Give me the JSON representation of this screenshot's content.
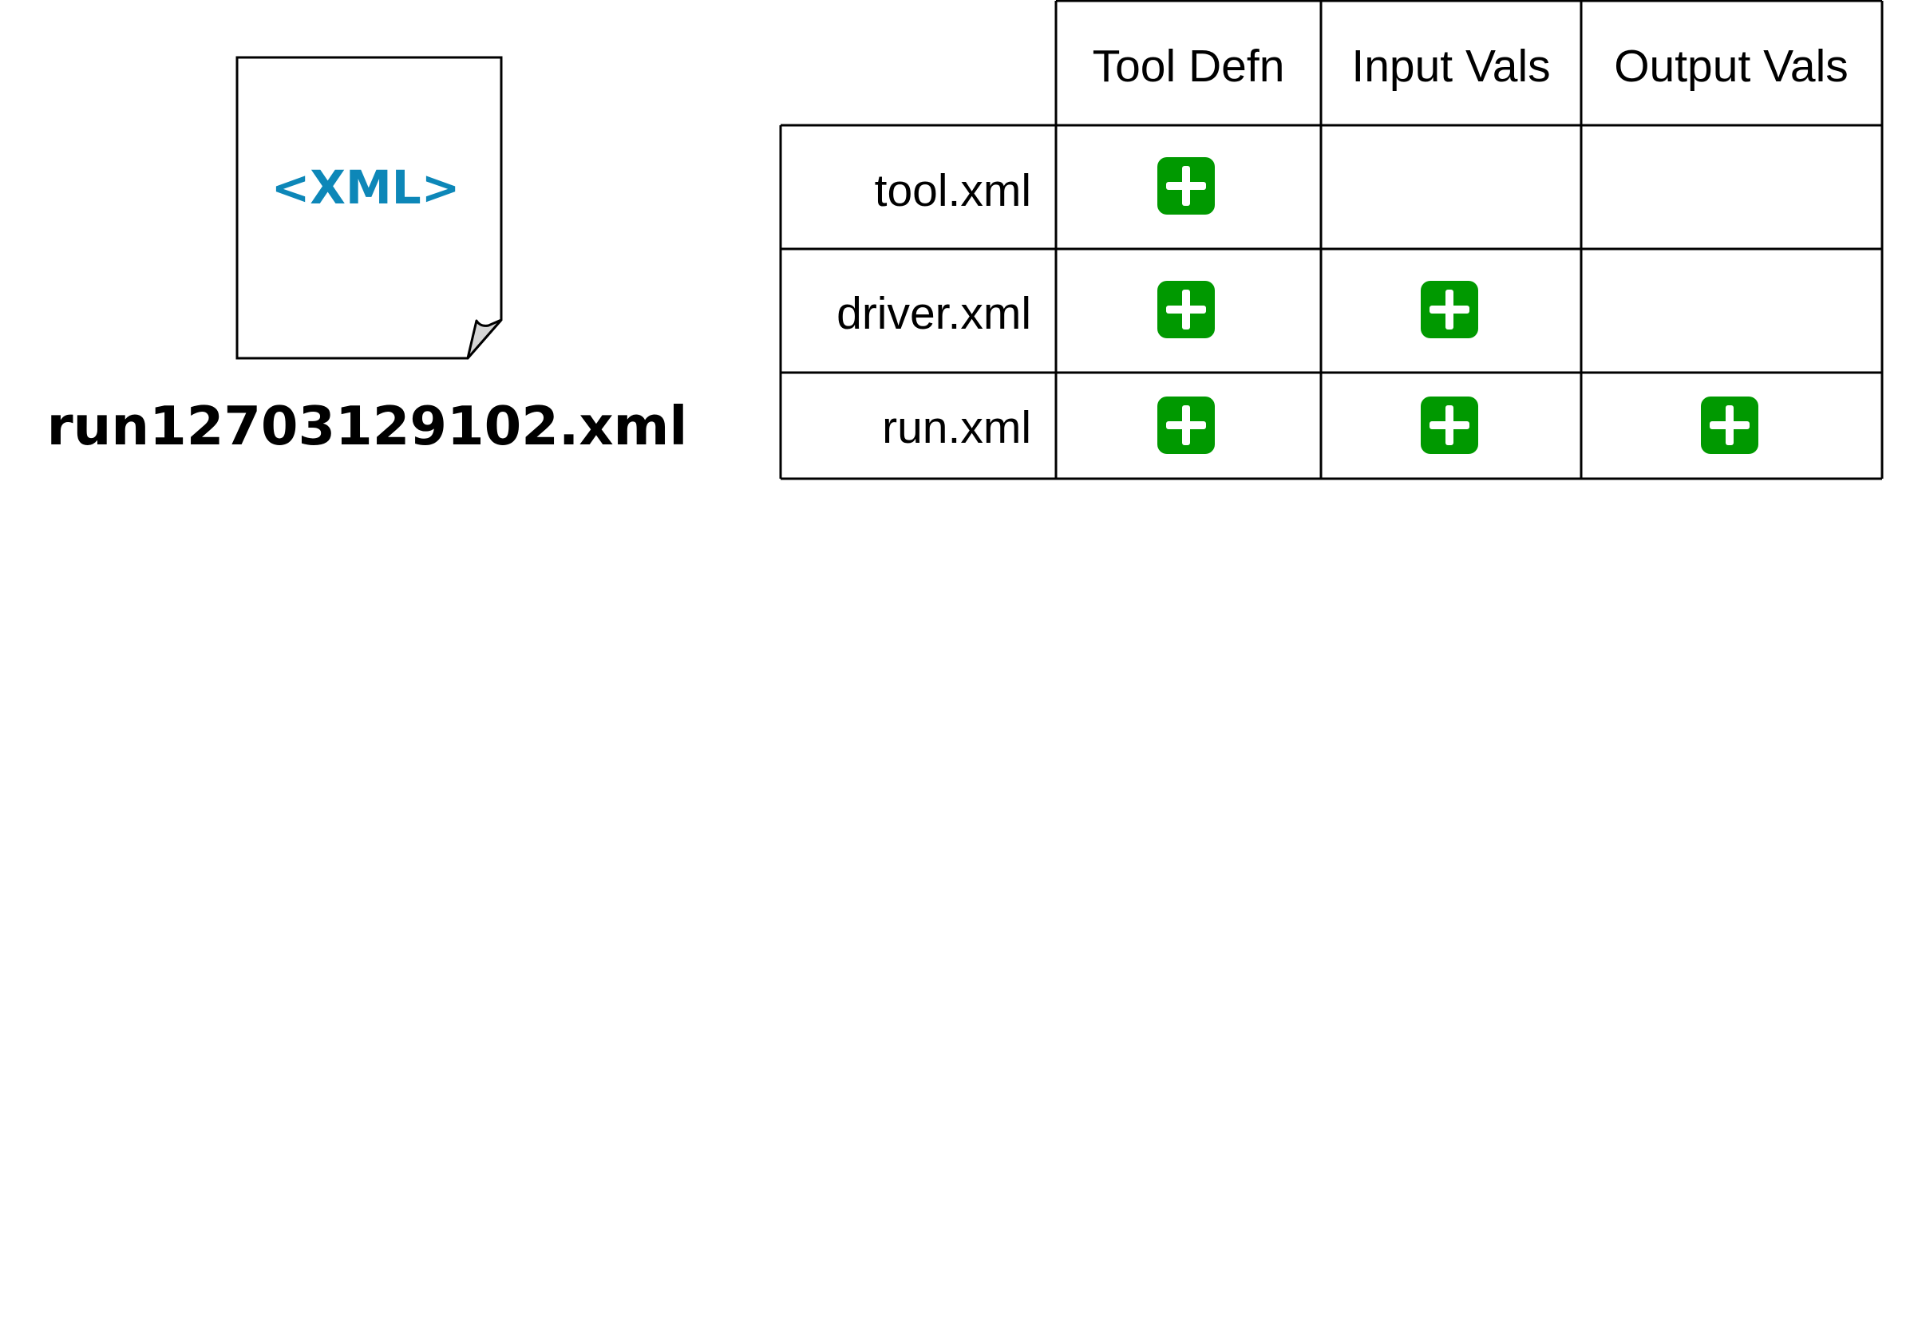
{
  "document": {
    "icon_text": "<XML>",
    "filename": "run12703129102.xml",
    "icon_text_color": "#0d87b8"
  },
  "table": {
    "columns": [
      "Tool Defn",
      "Input Vals",
      "Output Vals"
    ],
    "rows": [
      {
        "label": "tool.xml",
        "checks": [
          true,
          false,
          false
        ]
      },
      {
        "label": "driver.xml",
        "checks": [
          true,
          true,
          false
        ]
      },
      {
        "label": "run.xml",
        "checks": [
          true,
          true,
          true
        ]
      }
    ],
    "check_icon": "plus-icon",
    "check_color": "#009900"
  }
}
